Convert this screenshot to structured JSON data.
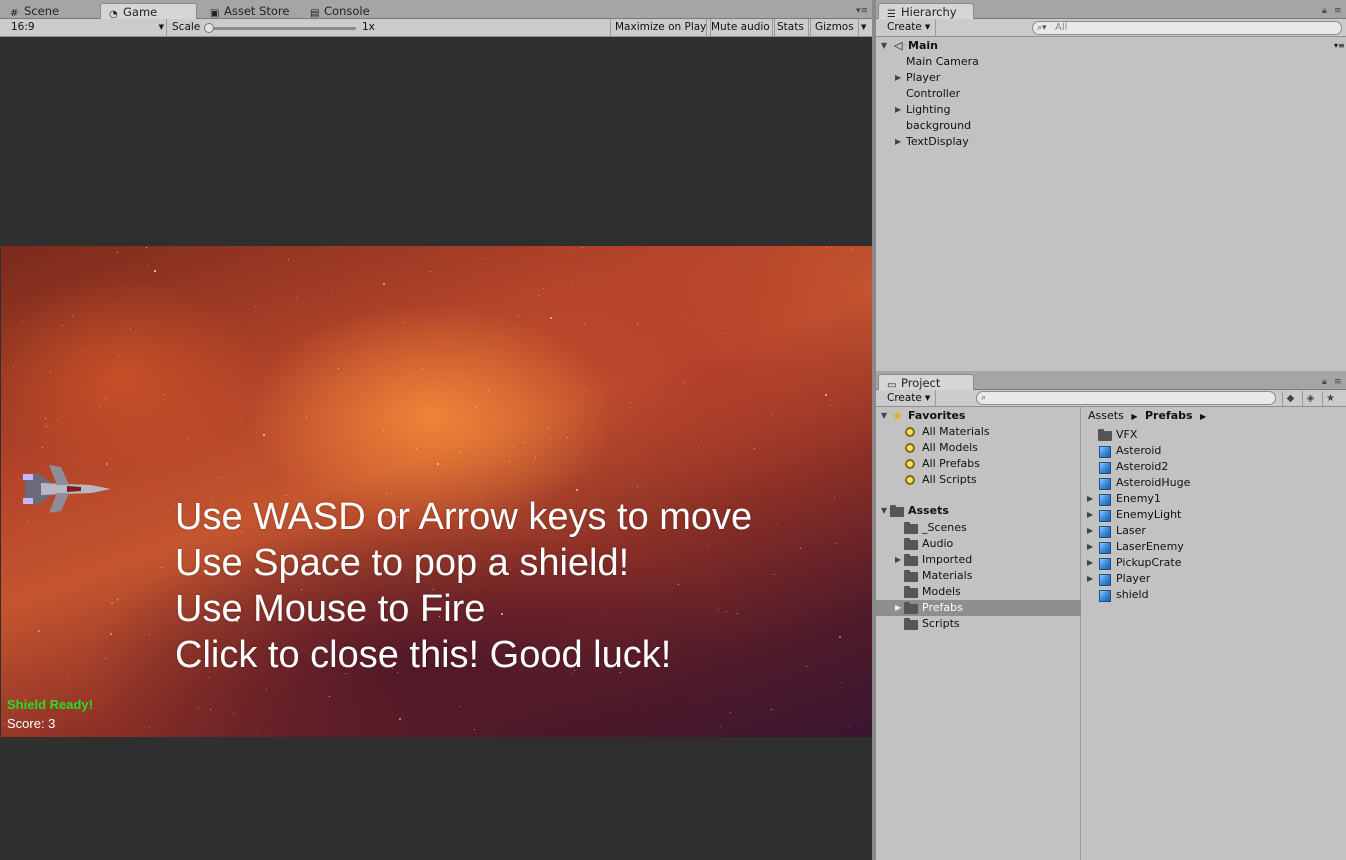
{
  "scene_tabs": {
    "scene": "Scene",
    "game": "Game",
    "asset_store": "Asset Store",
    "console": "Console"
  },
  "game_toolbar": {
    "aspect": "16:9",
    "scale_label": "Scale",
    "scale_value": "1x",
    "maximize_on_play": "Maximize on Play",
    "mute_audio": "Mute audio",
    "stats": "Stats",
    "gizmos": "Gizmos"
  },
  "game": {
    "instructions": [
      "Use WASD or Arrow keys to move",
      "Use Space to pop a shield!",
      "Use Mouse to Fire",
      "Click to close this! Good luck!"
    ],
    "shield_status": "Shield Ready!",
    "score": "Score: 3"
  },
  "hierarchy": {
    "tab": "Hierarchy",
    "create": "Create",
    "search_placeholder": "All",
    "scene_name": "Main",
    "items": [
      {
        "label": "Main Camera",
        "expandable": false
      },
      {
        "label": "Player",
        "expandable": true
      },
      {
        "label": "Controller",
        "expandable": false
      },
      {
        "label": "Lighting",
        "expandable": true
      },
      {
        "label": "background",
        "expandable": false
      },
      {
        "label": "TextDisplay",
        "expandable": true
      }
    ]
  },
  "project": {
    "tab": "Project",
    "create": "Create",
    "favorites_label": "Favorites",
    "favorites": [
      "All Materials",
      "All Models",
      "All Prefabs",
      "All Scripts"
    ],
    "assets_label": "Assets",
    "folders": [
      {
        "label": "_Scenes",
        "expandable": false,
        "selected": false
      },
      {
        "label": "Audio",
        "expandable": false,
        "selected": false
      },
      {
        "label": "Imported",
        "expandable": true,
        "selected": false
      },
      {
        "label": "Materials",
        "expandable": false,
        "selected": false
      },
      {
        "label": "Models",
        "expandable": false,
        "selected": false
      },
      {
        "label": "Prefabs",
        "expandable": true,
        "selected": true
      },
      {
        "label": "Scripts",
        "expandable": false,
        "selected": false
      }
    ],
    "breadcrumb_root": "Assets",
    "breadcrumb_current": "Prefabs",
    "contents": [
      {
        "label": "VFX",
        "kind": "folder",
        "expandable": false
      },
      {
        "label": "Asteroid",
        "kind": "prefab",
        "expandable": false
      },
      {
        "label": "Asteroid2",
        "kind": "prefab",
        "expandable": false
      },
      {
        "label": "AsteroidHuge",
        "kind": "prefab",
        "expandable": false
      },
      {
        "label": "Enemy1",
        "kind": "prefab",
        "expandable": true
      },
      {
        "label": "EnemyLight",
        "kind": "prefab",
        "expandable": true
      },
      {
        "label": "Laser",
        "kind": "prefab",
        "expandable": true
      },
      {
        "label": "LaserEnemy",
        "kind": "prefab",
        "expandable": true
      },
      {
        "label": "PickupCrate",
        "kind": "prefab",
        "expandable": true
      },
      {
        "label": "Player",
        "kind": "prefab",
        "expandable": true
      },
      {
        "label": "shield",
        "kind": "prefab",
        "expandable": false
      }
    ]
  },
  "colors": {
    "shield_ready": "#22e026",
    "editor_bg": "#c2c2c2",
    "selection": "#8f8f8f"
  }
}
